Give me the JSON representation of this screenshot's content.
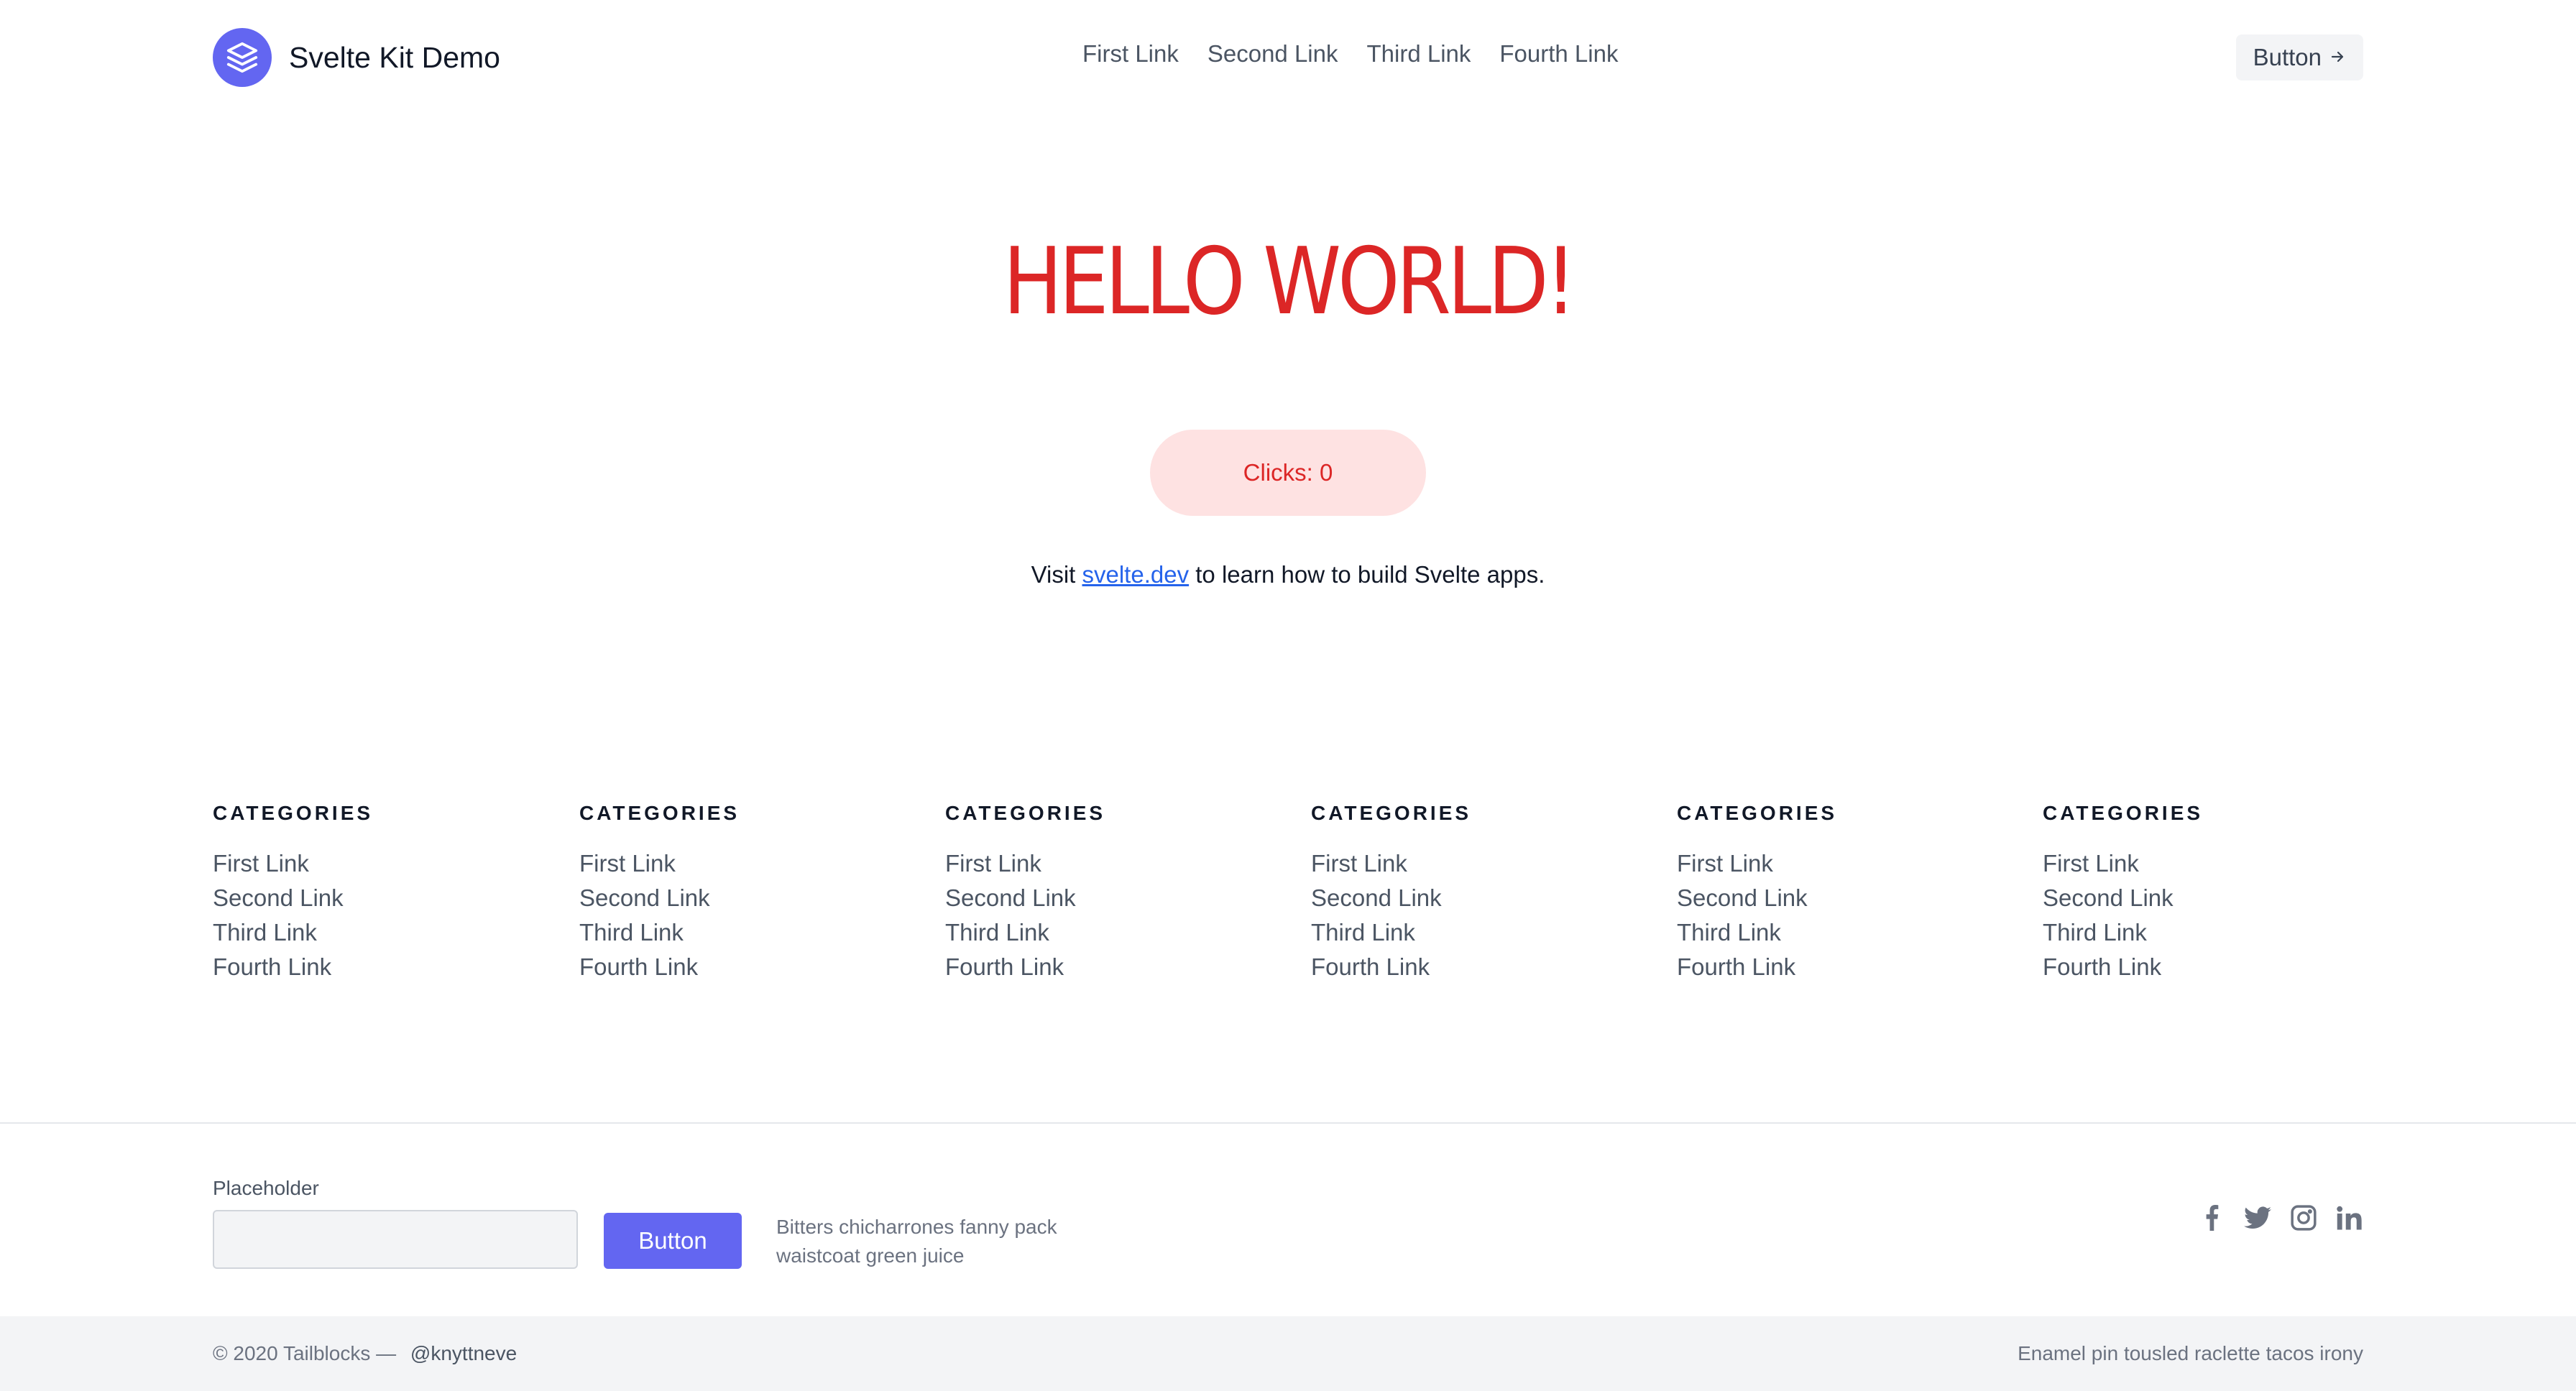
{
  "header": {
    "brand": "Svelte Kit Demo",
    "nav": [
      "First Link",
      "Second Link",
      "Third Link",
      "Fourth Link"
    ],
    "button_label": "Button",
    "button_icon": "arrow-right-icon"
  },
  "hero": {
    "title": "HELLO WORLD!",
    "clicks_label": "Clicks: 0",
    "visit_prefix": "Visit",
    "visit_link": "svelte.dev",
    "visit_suffix": "to learn how to build Svelte apps."
  },
  "categories": [
    {
      "heading": "CATEGORIES",
      "links": [
        "First Link",
        "Second Link",
        "Third Link",
        "Fourth Link"
      ]
    },
    {
      "heading": "CATEGORIES",
      "links": [
        "First Link",
        "Second Link",
        "Third Link",
        "Fourth Link"
      ]
    },
    {
      "heading": "CATEGORIES",
      "links": [
        "First Link",
        "Second Link",
        "Third Link",
        "Fourth Link"
      ]
    },
    {
      "heading": "CATEGORIES",
      "links": [
        "First Link",
        "Second Link",
        "Third Link",
        "Fourth Link"
      ]
    },
    {
      "heading": "CATEGORIES",
      "links": [
        "First Link",
        "Second Link",
        "Third Link",
        "Fourth Link"
      ]
    },
    {
      "heading": "CATEGORIES",
      "links": [
        "First Link",
        "Second Link",
        "Third Link",
        "Fourth Link"
      ]
    }
  ],
  "subscribe": {
    "label": "Placeholder",
    "input_value": "",
    "button_label": "Button",
    "text": "Bitters chicharrones fanny pack waistcoat green juice"
  },
  "socials": [
    "facebook-icon",
    "twitter-icon",
    "instagram-icon",
    "linkedin-icon"
  ],
  "footer": {
    "copyright": "© 2020 Tailblocks —",
    "handle": "@knyttneve",
    "tagline": "Enamel pin tousled raclette tacos irony"
  },
  "colors": {
    "accent": "#6366f1",
    "hero_red": "#dc2626",
    "clicks_bg": "#fee2e2",
    "link_blue": "#2563eb"
  }
}
